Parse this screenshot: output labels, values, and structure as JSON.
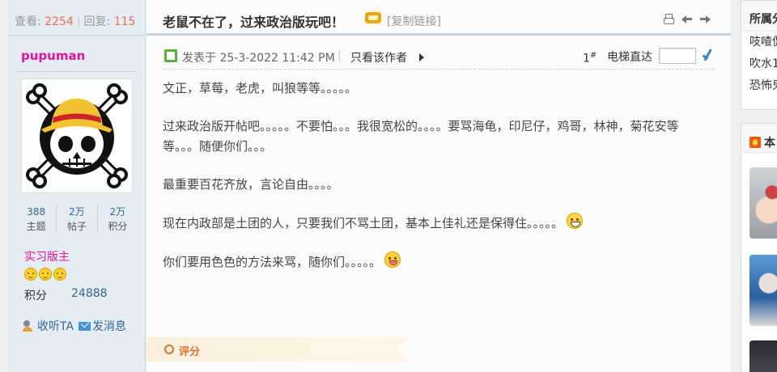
{
  "stats": {
    "views_label": "查看:",
    "views": "2254",
    "replies_label": "回复:",
    "replies": "115",
    "separator": "|"
  },
  "author": {
    "name": "pupuman",
    "avatar_icon": "skull-jolly-roger-avatar",
    "stats": [
      {
        "value": "388",
        "label": "主题"
      },
      {
        "value": "2万",
        "label": "帖子"
      },
      {
        "value": "2万",
        "label": "积分"
      }
    ],
    "group": "实习版主",
    "medal_count": 3,
    "credits_label": "积分",
    "credits_value": "24888",
    "follow_label": "收听TA",
    "message_label": "发消息"
  },
  "thread": {
    "title": "老鼠不在了，过来政治版玩吧！",
    "copy_link": "[复制链接]",
    "icons": [
      "print-icon",
      "prev-thread-icon",
      "next-thread-icon"
    ]
  },
  "post": {
    "posted_prefix": "发表于",
    "posted_at": "25-3-2022 11:42 PM",
    "meta_sep": "|",
    "only_author": "只看该作者",
    "floor": "1",
    "floor_mark": "#",
    "jump_label": "电梯直达",
    "jump_value": "",
    "paragraphs": [
      "文正，草莓，老虎，叫狼等等。。。。。",
      "过来政治版开帖吧。。。。。不要怕。。。我很宽松的。。。。要骂海龟，印尼仔，鸡哥，林神，菊花安等等。。。随便你们。。。",
      "最重要百花齐放，言论自由。。。。",
      "现在内政部是土团的人，只要我们不骂土团，基本上佳礼还是保得住。。。。。",
      "你们要用色色的方法来骂，随你们。。。。。"
    ],
    "rate_label": "评分"
  },
  "sidebar": {
    "forum_title": "所属分",
    "forum_items": [
      "吱喳侃",
      "吹水1",
      "恐怖鬼"
    ],
    "hot_title": "本"
  },
  "colors": {
    "accent_pink": "#e5139a",
    "count_orange": "#f26c4f",
    "link_blue": "#336699",
    "rate_orange": "#e66e2e"
  }
}
